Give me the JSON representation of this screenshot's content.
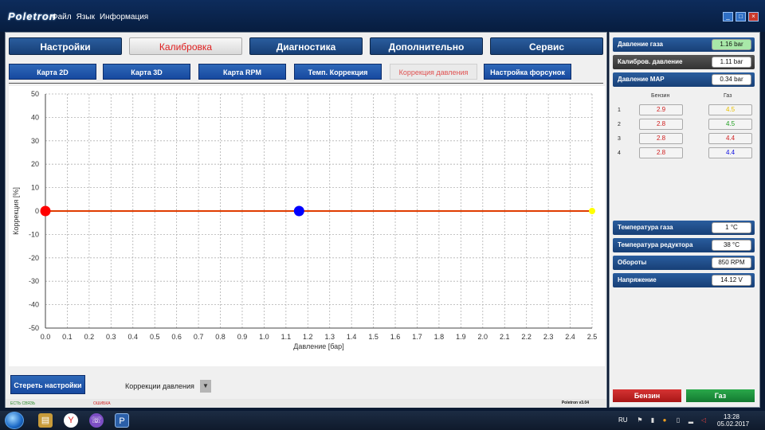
{
  "app": {
    "logo": "Poletron",
    "menu": [
      "Файл",
      "Язык",
      "Информация"
    ]
  },
  "tabs": [
    {
      "label": "Настройки",
      "active": false
    },
    {
      "label": "Калибровка",
      "active": true
    },
    {
      "label": "Диагностика",
      "active": false
    },
    {
      "label": "Дополнительно",
      "active": false
    },
    {
      "label": "Сервис",
      "active": false
    }
  ],
  "subtabs": [
    {
      "label": "Карта 2D",
      "active": false
    },
    {
      "label": "Карта 3D",
      "active": false
    },
    {
      "label": "Карта RPM",
      "active": false
    },
    {
      "label": "Темп. Коррекция",
      "active": false
    },
    {
      "label": "Коррекция давления",
      "active": true
    },
    {
      "label": "Настройка форсунок",
      "active": false
    }
  ],
  "chart_data": {
    "type": "line",
    "title": "",
    "xlabel": "Давление [бар]",
    "ylabel": "Коррекция [%]",
    "xlim": [
      0.0,
      2.5
    ],
    "ylim": [
      -50,
      50
    ],
    "xticks": [
      0.0,
      0.1,
      0.2,
      0.3,
      0.4,
      0.5,
      0.6,
      0.7,
      0.8,
      0.9,
      1.0,
      1.1,
      1.2,
      1.3,
      1.4,
      1.5,
      1.6,
      1.7,
      1.8,
      1.9,
      2.0,
      2.1,
      2.2,
      2.3,
      2.4,
      2.5
    ],
    "yticks": [
      50,
      40,
      30,
      20,
      10,
      0,
      -10,
      -20,
      -30,
      -40,
      -50
    ],
    "grid": true,
    "series": [
      {
        "x": [
          0.0,
          2.5
        ],
        "y": [
          0,
          0
        ],
        "color": "#e03c00"
      }
    ],
    "markers": [
      {
        "x": 0.0,
        "y": 0,
        "color": "#ff0000"
      },
      {
        "x": 1.16,
        "y": 0,
        "color": "#0000ff"
      },
      {
        "x": 2.5,
        "y": 0,
        "color": "#ffff00"
      }
    ]
  },
  "bottom": {
    "clear_button": "Стереть настройки",
    "dropdown_value": "Коррекции давления"
  },
  "status": {
    "link": "ЕСТЬ СВЯЗЬ",
    "error": "ОШИБКА",
    "version": "Poletron v3.04"
  },
  "right_panel": {
    "readings_top": [
      {
        "label": "Давление газа",
        "value": "1.16 bar",
        "highlight": true
      },
      {
        "label": "Калибров. давление",
        "value": "1.11 bar",
        "highlight": false
      },
      {
        "label": "Давление MAP",
        "value": "0.34 bar",
        "highlight": false
      }
    ],
    "injectors": {
      "header_benzin": "Бензин",
      "header_gaz": "Газ",
      "rows": [
        {
          "num": "1",
          "benzin": "2.9",
          "gaz": "4.5",
          "gaz_color": "#e8c000"
        },
        {
          "num": "2",
          "benzin": "2.8",
          "gaz": "4.5",
          "gaz_color": "#22a022"
        },
        {
          "num": "3",
          "benzin": "2.8",
          "gaz": "4.4",
          "gaz_color": "#d02020"
        },
        {
          "num": "4",
          "benzin": "2.8",
          "gaz": "4.4",
          "gaz_color": "#1010e0"
        }
      ]
    },
    "readings_bottom": [
      {
        "label": "Температура газа",
        "value": "1 °C"
      },
      {
        "label": "Температура редуктора",
        "value": "38 °C"
      },
      {
        "label": "Обороты",
        "value": "850 RPM"
      },
      {
        "label": "Напряжение",
        "value": "14.12 V"
      }
    ],
    "buttons": {
      "benzin": "Бензин",
      "gaz": "Газ"
    }
  },
  "taskbar": {
    "lang": "RU",
    "time": "13:28",
    "date": "05.02.2017"
  }
}
